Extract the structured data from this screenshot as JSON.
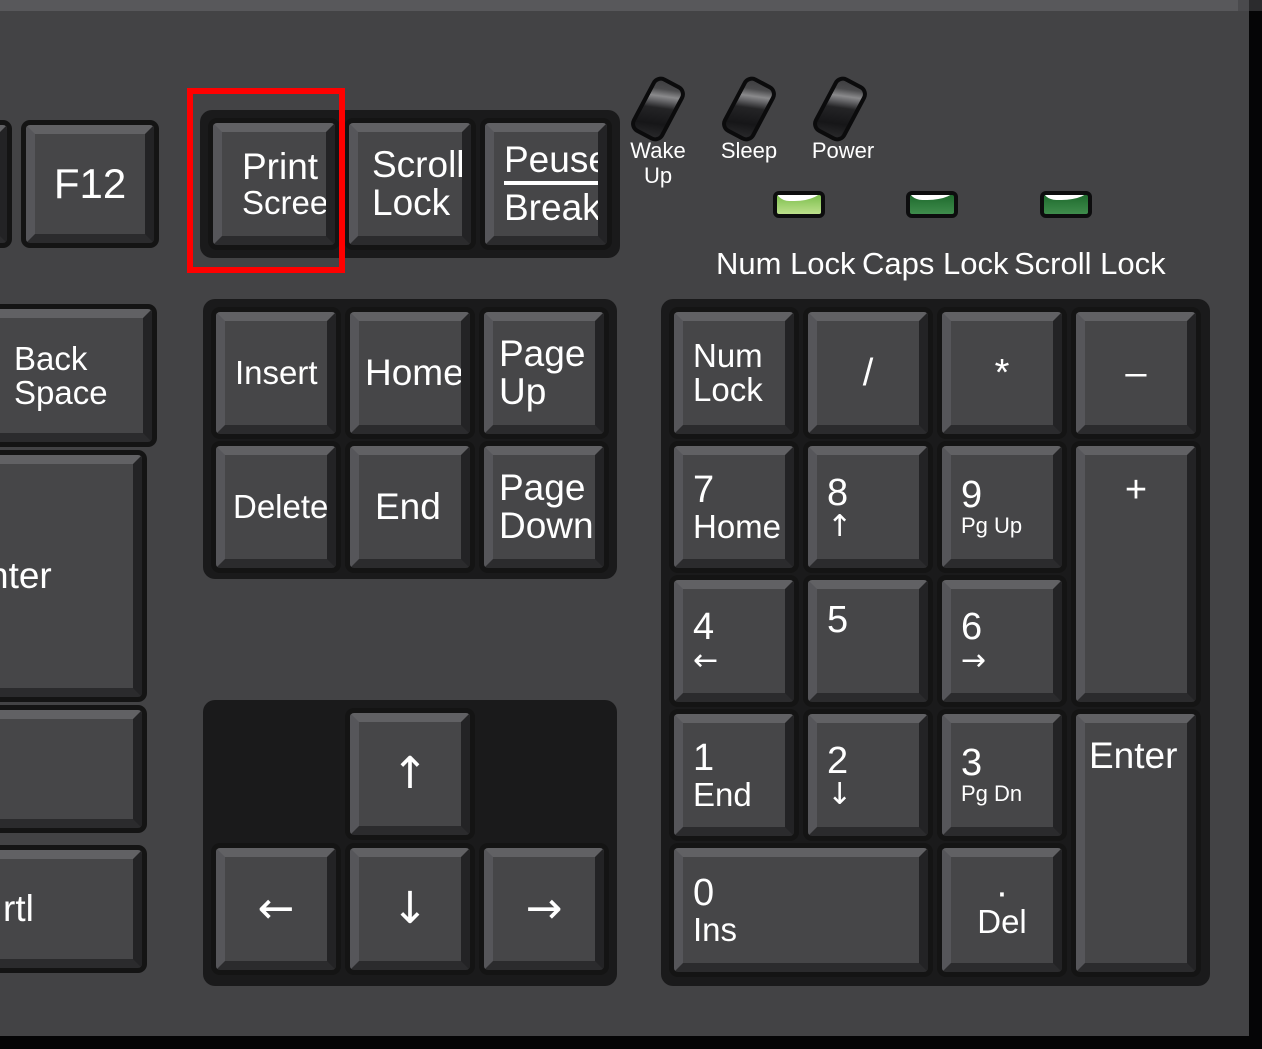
{
  "device": {
    "type": "computer-keyboard",
    "description": "Close-up photo-style illustration of the right portion of a black PC keyboard with the Print Screen key highlighted by a red rectangle",
    "body_color": "#434345",
    "key_face_color": "#464648",
    "key_border_color": "#141414",
    "legend_color": "#ffffff",
    "highlight_color": "#ff0000"
  },
  "highlight": {
    "target_key": "Print Screen",
    "color": "#ff0000",
    "border_px": 6
  },
  "left_partial_keys": [
    {
      "id": "f12",
      "label": "F12",
      "lines": [
        "F12"
      ]
    },
    {
      "id": "backspace",
      "label": "Back Space",
      "lines": [
        "Back",
        "Space"
      ]
    },
    {
      "id": "enter",
      "label": "Enter",
      "lines": [
        "nter"
      ]
    },
    {
      "id": "shift",
      "label": "",
      "lines": [
        ""
      ]
    },
    {
      "id": "ctrl",
      "label": "Ctrl",
      "lines": [
        "rtl"
      ]
    }
  ],
  "function_cluster": {
    "keys": [
      {
        "id": "printscreen",
        "lines": [
          "Print",
          "Screen"
        ],
        "highlighted": true
      },
      {
        "id": "scrolllock",
        "lines": [
          "Scroll",
          "Lock"
        ],
        "highlighted": false
      },
      {
        "id": "pausebreak",
        "lines": [
          "Peuse",
          "Break"
        ],
        "highlighted": false,
        "divider": true
      }
    ]
  },
  "power_buttons": [
    {
      "id": "wakeup",
      "label": "Wake\nUp"
    },
    {
      "id": "sleep",
      "label": "Sleep"
    },
    {
      "id": "power",
      "label": "Power"
    }
  ],
  "indicator_leds": [
    {
      "id": "numlock",
      "label": "Num Lock",
      "state": "on",
      "color": "#a9d97a"
    },
    {
      "id": "capslock",
      "label": "Caps Lock",
      "state": "off",
      "color": "#2e7d3a"
    },
    {
      "id": "scrolllock",
      "label": "Scroll Lock",
      "state": "off",
      "color": "#2e7d3a"
    }
  ],
  "navigation_cluster": {
    "rows": [
      [
        {
          "id": "insert",
          "lines": [
            "Insert"
          ]
        },
        {
          "id": "home",
          "lines": [
            "Home"
          ]
        },
        {
          "id": "pageup",
          "lines": [
            "Page",
            "Up"
          ]
        }
      ],
      [
        {
          "id": "delete",
          "lines": [
            "Delete"
          ]
        },
        {
          "id": "end",
          "lines": [
            "End"
          ]
        },
        {
          "id": "pagedown",
          "lines": [
            "Page",
            "Down"
          ]
        }
      ]
    ]
  },
  "arrow_cluster": {
    "up": {
      "id": "arrow-up",
      "glyph": "↑"
    },
    "left": {
      "id": "arrow-left",
      "glyph": "←"
    },
    "down": {
      "id": "arrow-down",
      "glyph": "↓"
    },
    "right": {
      "id": "arrow-right",
      "glyph": "→"
    }
  },
  "numpad": {
    "keys": [
      {
        "id": "numlock",
        "top": "Num",
        "bottom": "Lock"
      },
      {
        "id": "divide",
        "top": "/",
        "bottom": ""
      },
      {
        "id": "multiply",
        "top": "*",
        "bottom": ""
      },
      {
        "id": "minus",
        "top": "–",
        "bottom": ""
      },
      {
        "id": "np7",
        "top": "7",
        "bottom": "Home"
      },
      {
        "id": "np8",
        "top": "8",
        "bottom": "↑"
      },
      {
        "id": "np9",
        "top": "9",
        "bottom": "Pg Up"
      },
      {
        "id": "plus",
        "top": "+",
        "bottom": ""
      },
      {
        "id": "np4",
        "top": "4",
        "bottom": "←"
      },
      {
        "id": "np5",
        "top": "5",
        "bottom": ""
      },
      {
        "id": "np6",
        "top": "6",
        "bottom": "→"
      },
      {
        "id": "np1",
        "top": "1",
        "bottom": "End"
      },
      {
        "id": "np2",
        "top": "2",
        "bottom": "↓"
      },
      {
        "id": "np3",
        "top": "3",
        "bottom": "Pg Dn"
      },
      {
        "id": "npenter",
        "top": "Enter",
        "bottom": ""
      },
      {
        "id": "np0",
        "top": "0",
        "bottom": "Ins"
      },
      {
        "id": "npdot",
        "top": "·",
        "bottom": "Del"
      }
    ]
  }
}
